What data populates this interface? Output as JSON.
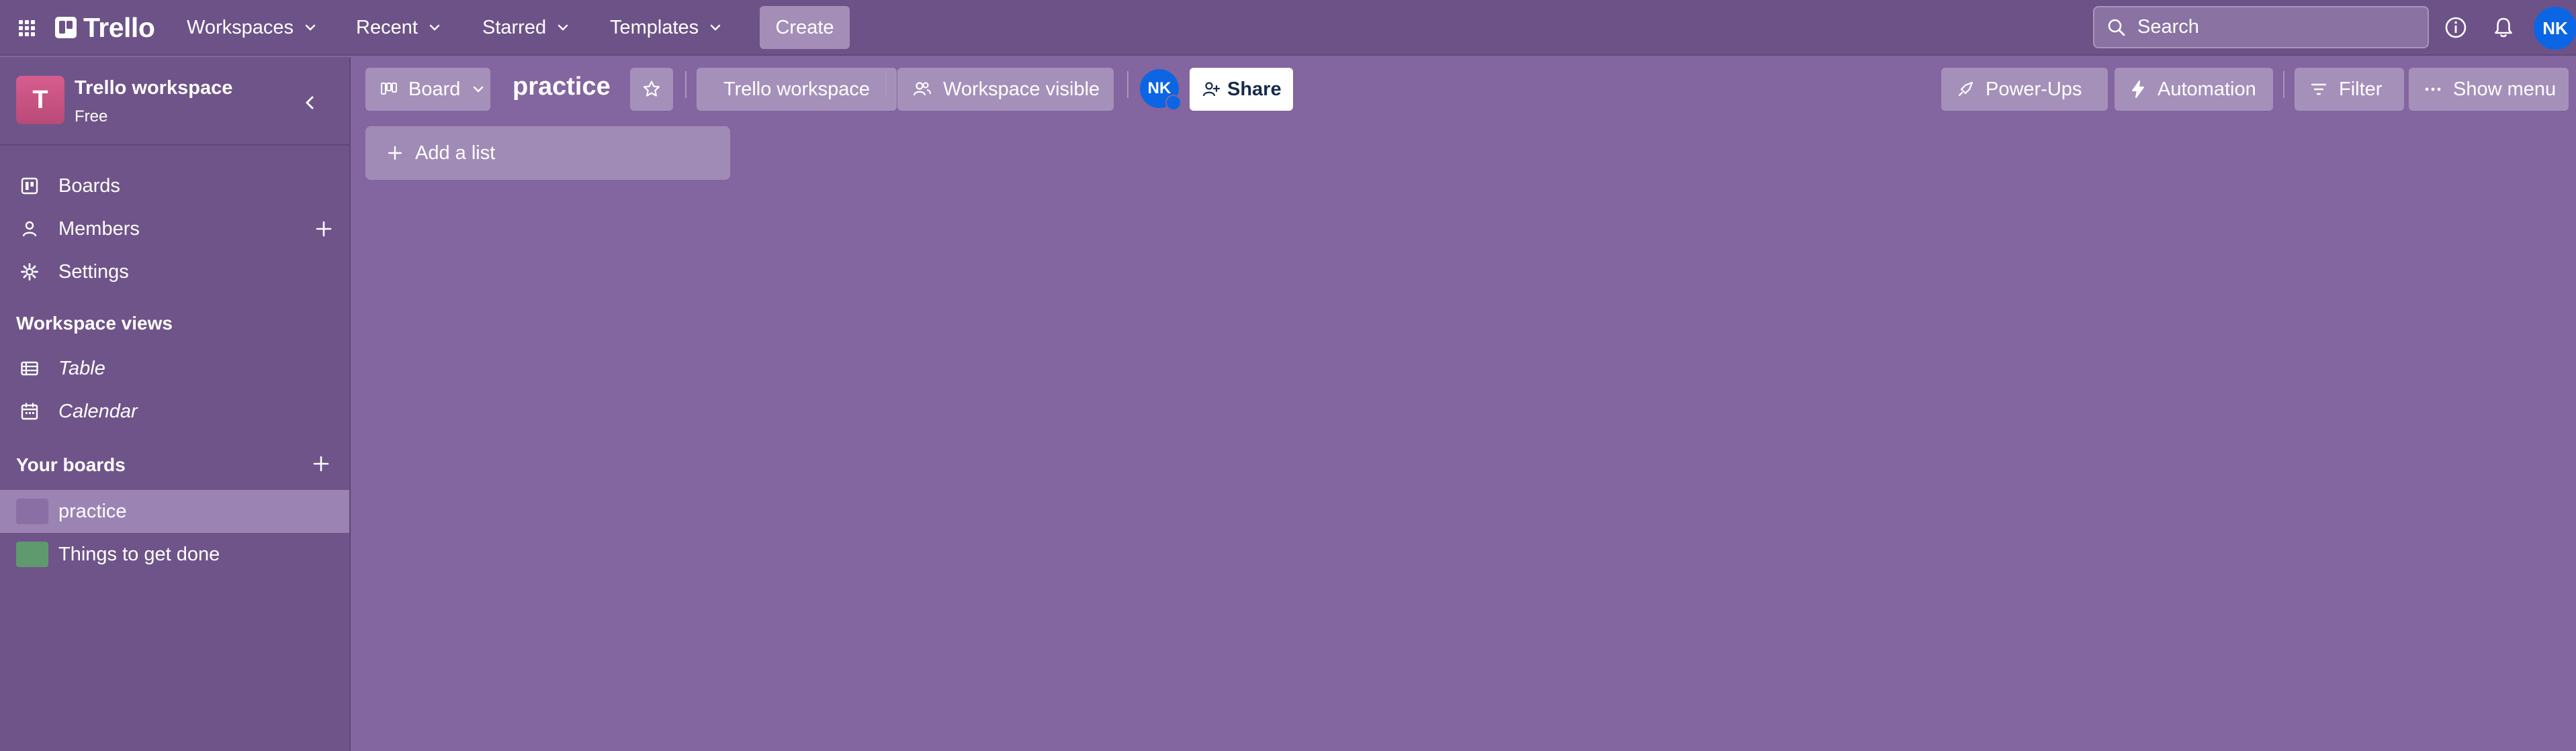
{
  "topnav": {
    "brand": "Trello",
    "menus": [
      {
        "label": "Workspaces"
      },
      {
        "label": "Recent"
      },
      {
        "label": "Starred"
      },
      {
        "label": "Templates"
      }
    ],
    "create_label": "Create",
    "search_placeholder": "Search",
    "user_initials": "NK"
  },
  "sidebar": {
    "workspace_initial": "T",
    "workspace_name": "Trello workspace",
    "workspace_plan": "Free",
    "nav": [
      {
        "label": "Boards",
        "icon": "boards-icon"
      },
      {
        "label": "Members",
        "icon": "person-icon"
      },
      {
        "label": "Settings",
        "icon": "gear-icon"
      }
    ],
    "views_title": "Workspace views",
    "views": [
      {
        "label": "Table",
        "icon": "table-icon"
      },
      {
        "label": "Calendar",
        "icon": "calendar-icon"
      }
    ],
    "boards_title": "Your boards",
    "boards": [
      {
        "label": "practice",
        "color": "#83659f",
        "active": true
      },
      {
        "label": "Things to get done",
        "color": "#5f9a6e",
        "active": false
      }
    ]
  },
  "board": {
    "view_label": "Board",
    "title": "practice",
    "workspace_label": "Trello workspace",
    "visibility_label": "Workspace visible",
    "member_initials": "NK",
    "share_label": "Share",
    "powerups_label": "Power-Ups",
    "automation_label": "Automation",
    "filter_label": "Filter",
    "show_menu_label": "Show menu",
    "add_list_label": "Add a list"
  },
  "colors": {
    "board_background": "#83659f",
    "topnav": "#6d5287",
    "sidebar": "#6f5489",
    "avatar": "#0c66e4"
  }
}
